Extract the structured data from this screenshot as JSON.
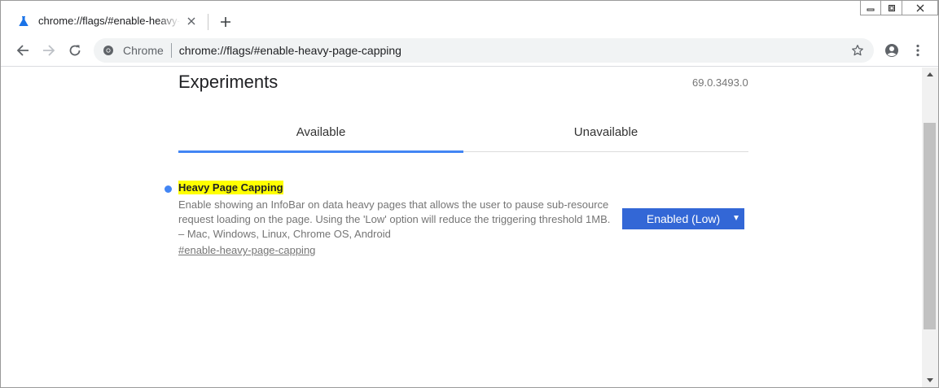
{
  "tab": {
    "title": "chrome://flags/#enable-heavy-page-capping",
    "favicon": "flask-icon"
  },
  "omnibox": {
    "chip": "Chrome",
    "url": "chrome://flags/#enable-heavy-page-capping"
  },
  "page": {
    "title": "Experiments",
    "version": "69.0.3493.0",
    "tabs": [
      {
        "label": "Available",
        "active": true
      },
      {
        "label": "Unavailable",
        "active": false
      }
    ]
  },
  "flag": {
    "name": "Heavy Page Capping",
    "description": "Enable showing an InfoBar on data heavy pages that allows the user to pause sub-resource request loading on the page. Using the 'Low' option will reduce the triggering threshold 1MB. – Mac, Windows, Linux, Chrome OS, Android",
    "link": "#enable-heavy-page-capping",
    "selected": "Enabled (Low)"
  },
  "colors": {
    "accent": "#4285f4",
    "select_bg": "#3367d6",
    "highlight": "#ffff00"
  }
}
